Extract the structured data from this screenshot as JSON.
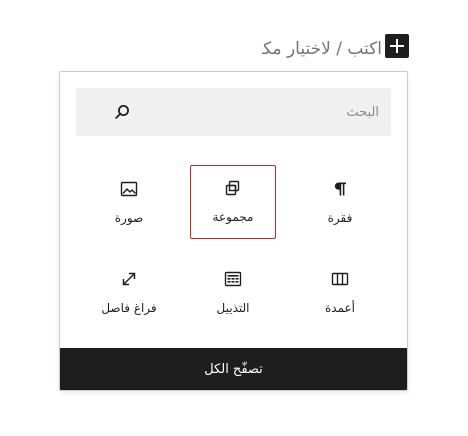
{
  "editor": {
    "placeholder_text": "اكتب / لاختيار مكوّن"
  },
  "inserter": {
    "toggle_label": "+",
    "search": {
      "placeholder": "البحث",
      "value": ""
    },
    "blocks": [
      {
        "label": "فقرة",
        "icon": "paragraph-icon"
      },
      {
        "label": "مجموعة",
        "icon": "group-icon",
        "highlighted": true
      },
      {
        "label": "صورة",
        "icon": "image-icon"
      },
      {
        "label": "أعمدة",
        "icon": "columns-icon"
      },
      {
        "label": "التذييل",
        "icon": "footer-icon"
      },
      {
        "label": "فراغ فاصل",
        "icon": "spacer-icon"
      }
    ],
    "browse_all_label": "تصفّح الكل"
  },
  "colors": {
    "accent_dark": "#1e1e1e",
    "search_background": "#f0f0f0",
    "highlight_border": "#c62828"
  }
}
